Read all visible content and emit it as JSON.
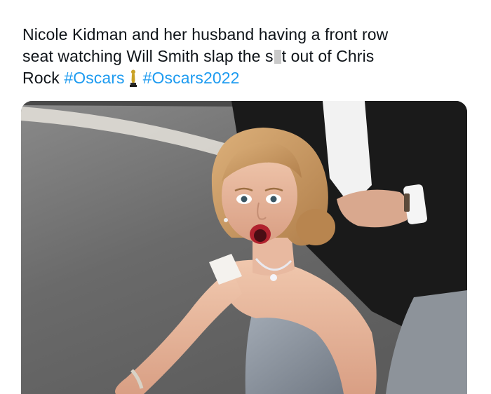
{
  "tweet": {
    "line1": "Nicole Kidman and her husband having a front row",
    "line2_before": "seat watching Will Smith slap the s",
    "line2_after": "t out of Chris",
    "line3_word": "Rock",
    "hashtag_1": "#Oscars",
    "hashtag_2": "#Oscars2022",
    "oscar_icon": "oscar-statuette-emoji"
  },
  "media": {
    "type": "photo",
    "colors": {
      "background_gray": "#6f6f6f",
      "hair": "#c99a62",
      "skin": "#e8b9a0",
      "dress": "#8d96a1",
      "suit": "#1a1a1a"
    }
  },
  "colors": {
    "text": "#0f1419",
    "link": "#1d9bf0",
    "censor": "#c9c9c9"
  }
}
